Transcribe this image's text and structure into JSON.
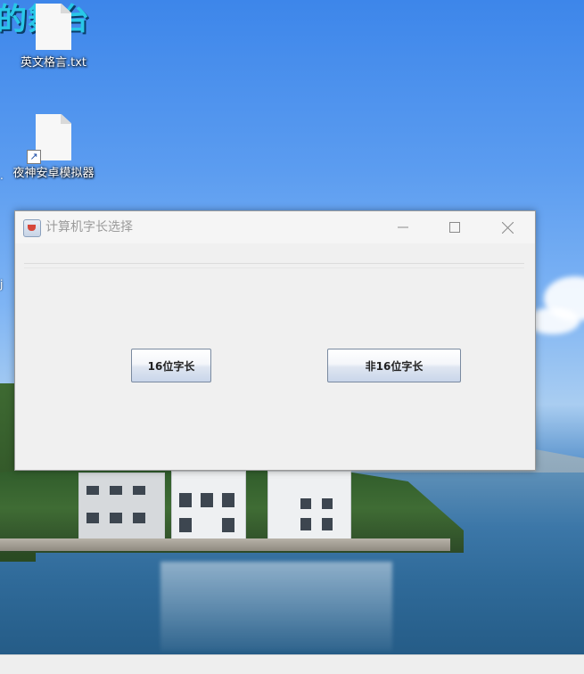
{
  "desktop": {
    "banner_text": "的舞台",
    "icons": [
      {
        "label": "英文格言.txt",
        "icon": "text-file-icon"
      },
      {
        "label": "夜神安卓模拟器",
        "icon": "shortcut-file-icon"
      }
    ],
    "edge_fragments": [
      ".",
      "j"
    ]
  },
  "window": {
    "title": "计算机字长选择",
    "controls": {
      "minimize": "minimize-icon",
      "maximize": "maximize-icon",
      "close": "close-icon"
    },
    "buttons": {
      "bit16_label": "16位字长",
      "non16_label": "非16位字长"
    }
  },
  "colors": {
    "button_border": "#7a8aa0",
    "window_bg": "#f0f0f0",
    "title_text": "#9b9b9b",
    "banner": "#29c7e8"
  }
}
